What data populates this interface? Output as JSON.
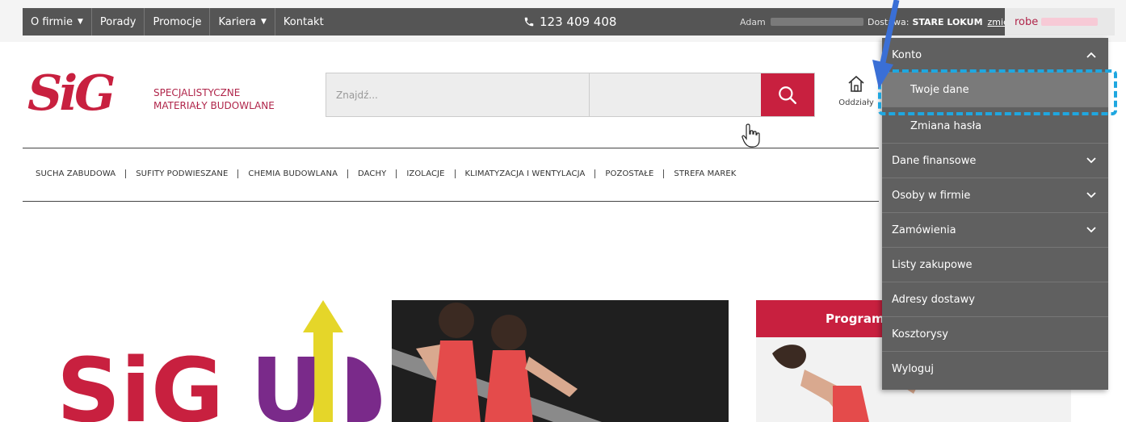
{
  "topbar": {
    "nav": [
      {
        "label": "O firmie",
        "caret": true
      },
      {
        "label": "Porady",
        "caret": false
      },
      {
        "label": "Promocje",
        "caret": false
      },
      {
        "label": "Kariera",
        "caret": true
      },
      {
        "label": "Kontakt",
        "caret": false
      }
    ],
    "phone": "123 409 408",
    "user_name": "Adam",
    "delivery_label": "Dostawa:",
    "delivery_value": "STARE LOKUM",
    "delivery_change": "zmień",
    "account_label": "robe"
  },
  "header": {
    "logo_text": "SiG",
    "tagline_line1": "SPECJALISTYCZNE",
    "tagline_line2": "MATERIAŁY BUDOWLANE",
    "search_placeholder": "Znajdź...",
    "branches_label": "Oddziały"
  },
  "categories": [
    "SUCHA ZABUDOWA",
    "SUFITY PODWIESZANE",
    "CHEMIA BUDOWLANA",
    "DACHY",
    "IZOLACJE",
    "KLIMATYZACJA I WENTYLACJA",
    "POZOSTAŁE",
    "STREFA MAREK"
  ],
  "banner": {
    "sigup_text_1": "SiG",
    "sigup_text_2": "U",
    "promo_title": "Program"
  },
  "dropdown": {
    "items": [
      {
        "label": "Konto",
        "chevron": "up"
      },
      {
        "label": "Twoje dane",
        "sub": true,
        "highlight": true
      },
      {
        "label": "Zmiana hasła",
        "sub": true
      },
      {
        "label": "Dane finansowe",
        "chevron": "down"
      },
      {
        "label": "Osoby w firmie",
        "chevron": "down"
      },
      {
        "label": "Zamówienia",
        "chevron": "down"
      },
      {
        "label": "Listy zakupowe"
      },
      {
        "label": "Adresy dostawy"
      },
      {
        "label": "Kosztorysy"
      },
      {
        "label": "Wyloguj"
      }
    ]
  },
  "colors": {
    "brand_red": "#c8203f",
    "topbar_bg": "#555555",
    "dropdown_bg": "#606060",
    "highlight_frame": "#1fa7e0",
    "arrow": "#3a6fd6"
  }
}
